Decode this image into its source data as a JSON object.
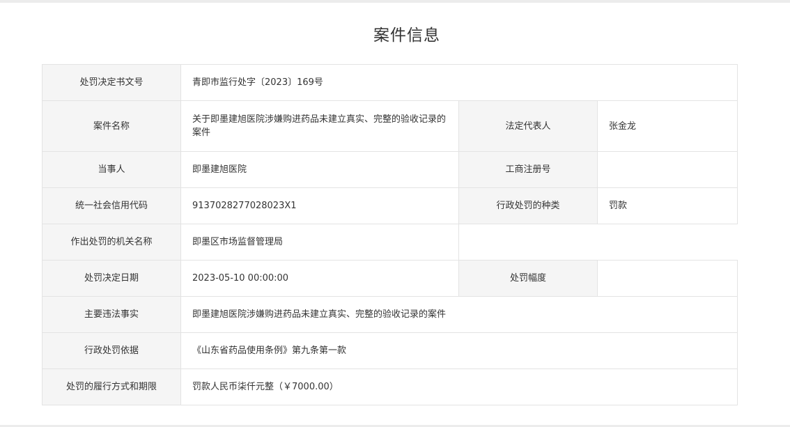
{
  "page": {
    "title": "案件信息"
  },
  "case": {
    "decision_no_label": "处罚决定书文号",
    "decision_no": "青即市监行处字〔2023〕169号",
    "case_name_label": "案件名称",
    "case_name": "关于即墨建旭医院涉嫌购进药品未建立真实、完整的验收记录的案件",
    "legal_rep_label": "法定代表人",
    "legal_rep": "张金龙",
    "party_label": "当事人",
    "party": "即墨建旭医院",
    "business_reg_label": "工商注册号",
    "business_reg": "",
    "credit_code_label": "统一社会信用代码",
    "credit_code": "9137028277028023X1",
    "penalty_type_label": "行政处罚的种类",
    "penalty_type": "罚款",
    "authority_label": "作出处罚的机关名称",
    "authority": "即墨区市场监督管理局",
    "decision_date_label": "处罚决定日期",
    "decision_date": "2023-05-10 00:00:00",
    "penalty_range_label": "处罚幅度",
    "penalty_range": "",
    "facts_label": "主要违法事实",
    "facts": "即墨建旭医院涉嫌购进药品未建立真实、完整的验收记录的案件",
    "basis_label": "行政处罚依据",
    "basis": "《山东省药品使用条例》第九条第一款",
    "performance_label": "处罚的履行方式和期限",
    "performance": "罚款人民币柒仟元整（￥7000.00）"
  }
}
